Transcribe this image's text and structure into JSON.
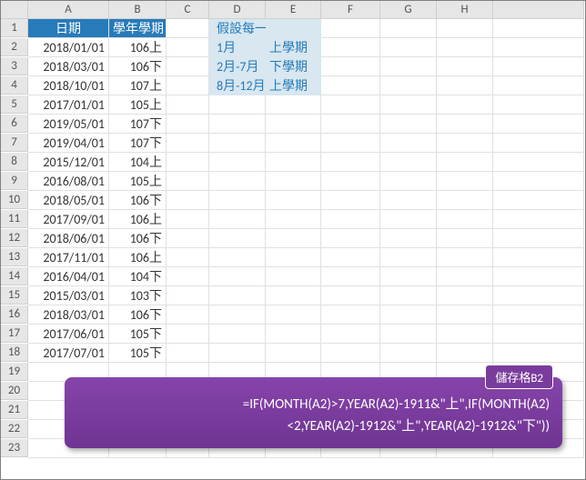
{
  "columns": [
    "A",
    "B",
    "C",
    "D",
    "E",
    "F",
    "G",
    "H"
  ],
  "rowCount": 23,
  "headers": {
    "A1": "日期",
    "B1": "學年學期"
  },
  "rows": [
    {
      "date": "2018/01/01",
      "term": "106上"
    },
    {
      "date": "2018/03/01",
      "term": "106下"
    },
    {
      "date": "2018/10/01",
      "term": "107上"
    },
    {
      "date": "2017/01/01",
      "term": "105上"
    },
    {
      "date": "2019/05/01",
      "term": "107下"
    },
    {
      "date": "2019/04/01",
      "term": "107下"
    },
    {
      "date": "2015/12/01",
      "term": "104上"
    },
    {
      "date": "2016/08/01",
      "term": "105上"
    },
    {
      "date": "2018/05/01",
      "term": "106下"
    },
    {
      "date": "2017/09/01",
      "term": "106上"
    },
    {
      "date": "2018/06/01",
      "term": "106下"
    },
    {
      "date": "2017/11/01",
      "term": "106上"
    },
    {
      "date": "2016/04/01",
      "term": "104下"
    },
    {
      "date": "2015/03/01",
      "term": "103下"
    },
    {
      "date": "2018/03/01",
      "term": "106下"
    },
    {
      "date": "2017/06/01",
      "term": "105下"
    },
    {
      "date": "2017/07/01",
      "term": "105下"
    }
  ],
  "info": {
    "title": "假設每一學年：",
    "r1a": "1月",
    "r1b": "上學期",
    "r2a": "2月-7月",
    "r2b": "下學期",
    "r3a": "8月-12月",
    "r3b": "上學期"
  },
  "formula": {
    "tag": "儲存格B2",
    "text": "=IF(MONTH(A2)>7,YEAR(A2)-1911&\"上\",IF(MONTH(A2)<2,YEAR(A2)-1912&\"上\",YEAR(A2)-1912&\"下\"))"
  }
}
